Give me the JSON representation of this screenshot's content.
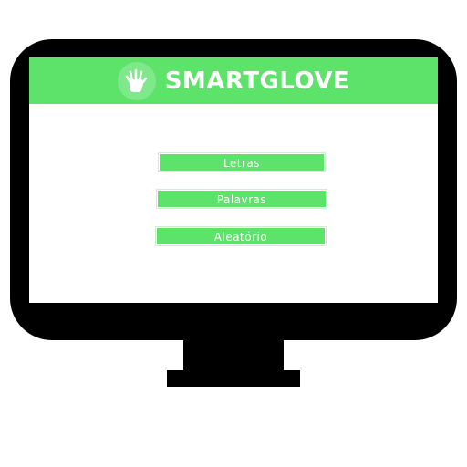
{
  "colors": {
    "accent": "#5de36a",
    "logo_circle": "#7ee88a",
    "monitor": "#000000",
    "screen": "#ffffff",
    "text_on_accent": "#ffffff"
  },
  "header": {
    "title": "SMARTGLOVE",
    "logo_icon": "hand-icon"
  },
  "menu": {
    "buttons": [
      {
        "label": "Letras"
      },
      {
        "label": "Palavras"
      },
      {
        "label": "Aleatório"
      }
    ]
  }
}
